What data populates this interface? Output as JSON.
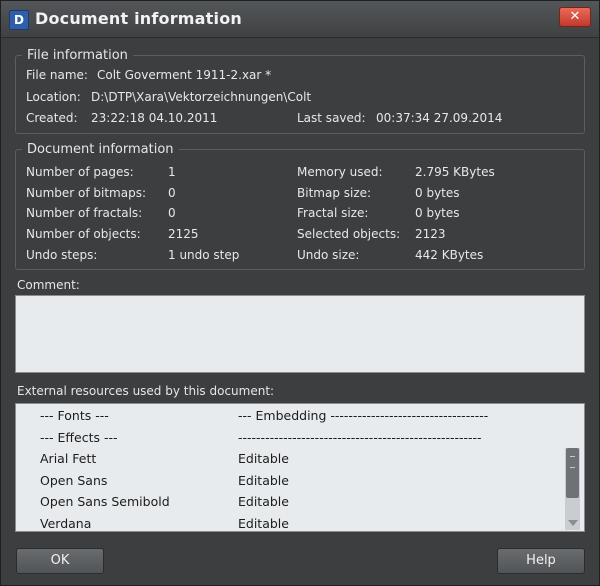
{
  "window": {
    "title": "Document information",
    "app_icon_letter": "D",
    "close_glyph": "✕"
  },
  "file_info": {
    "legend": "File information",
    "file_name_label": "File name:",
    "file_name": "Colt Goverment 1911-2.xar *",
    "location_label": "Location:",
    "location": "D:\\DTP\\Xara\\Vektorzeichnungen\\Colt",
    "created_label": "Created:",
    "created": "23:22:18  04.10.2011",
    "last_saved_label": "Last saved:",
    "last_saved": "00:37:34  27.09.2014"
  },
  "doc_info": {
    "legend": "Document information",
    "left": [
      {
        "label": "Number of pages:",
        "value": "1"
      },
      {
        "label": "Number of bitmaps:",
        "value": "0"
      },
      {
        "label": "Number of fractals:",
        "value": "0"
      },
      {
        "label": "Number of objects:",
        "value": "2125"
      },
      {
        "label": "Undo steps:",
        "value": "1 undo step"
      }
    ],
    "right": [
      {
        "label": "Memory used:",
        "value": "2.795 KBytes"
      },
      {
        "label": "Bitmap size:",
        "value": "0 bytes"
      },
      {
        "label": "Fractal size:",
        "value": "0 bytes"
      },
      {
        "label": "Selected objects:",
        "value": "2123"
      },
      {
        "label": "Undo size:",
        "value": "442 KBytes"
      }
    ]
  },
  "comment": {
    "label": "Comment:",
    "value": ""
  },
  "resources": {
    "label": "External resources used by this document:",
    "rows": [
      {
        "name": "--- Fonts ---",
        "status": "--- Embedding -----------------------------------"
      },
      {
        "name": "--- Effects ---",
        "status": "------------------------------------------------------"
      },
      {
        "name": "Arial Fett",
        "status": "Editable"
      },
      {
        "name": "Open Sans",
        "status": "Editable"
      },
      {
        "name": "Open Sans Semibold",
        "status": "Editable"
      },
      {
        "name": "Verdana",
        "status": "Editable"
      }
    ]
  },
  "buttons": {
    "ok": "OK",
    "help": "Help"
  }
}
